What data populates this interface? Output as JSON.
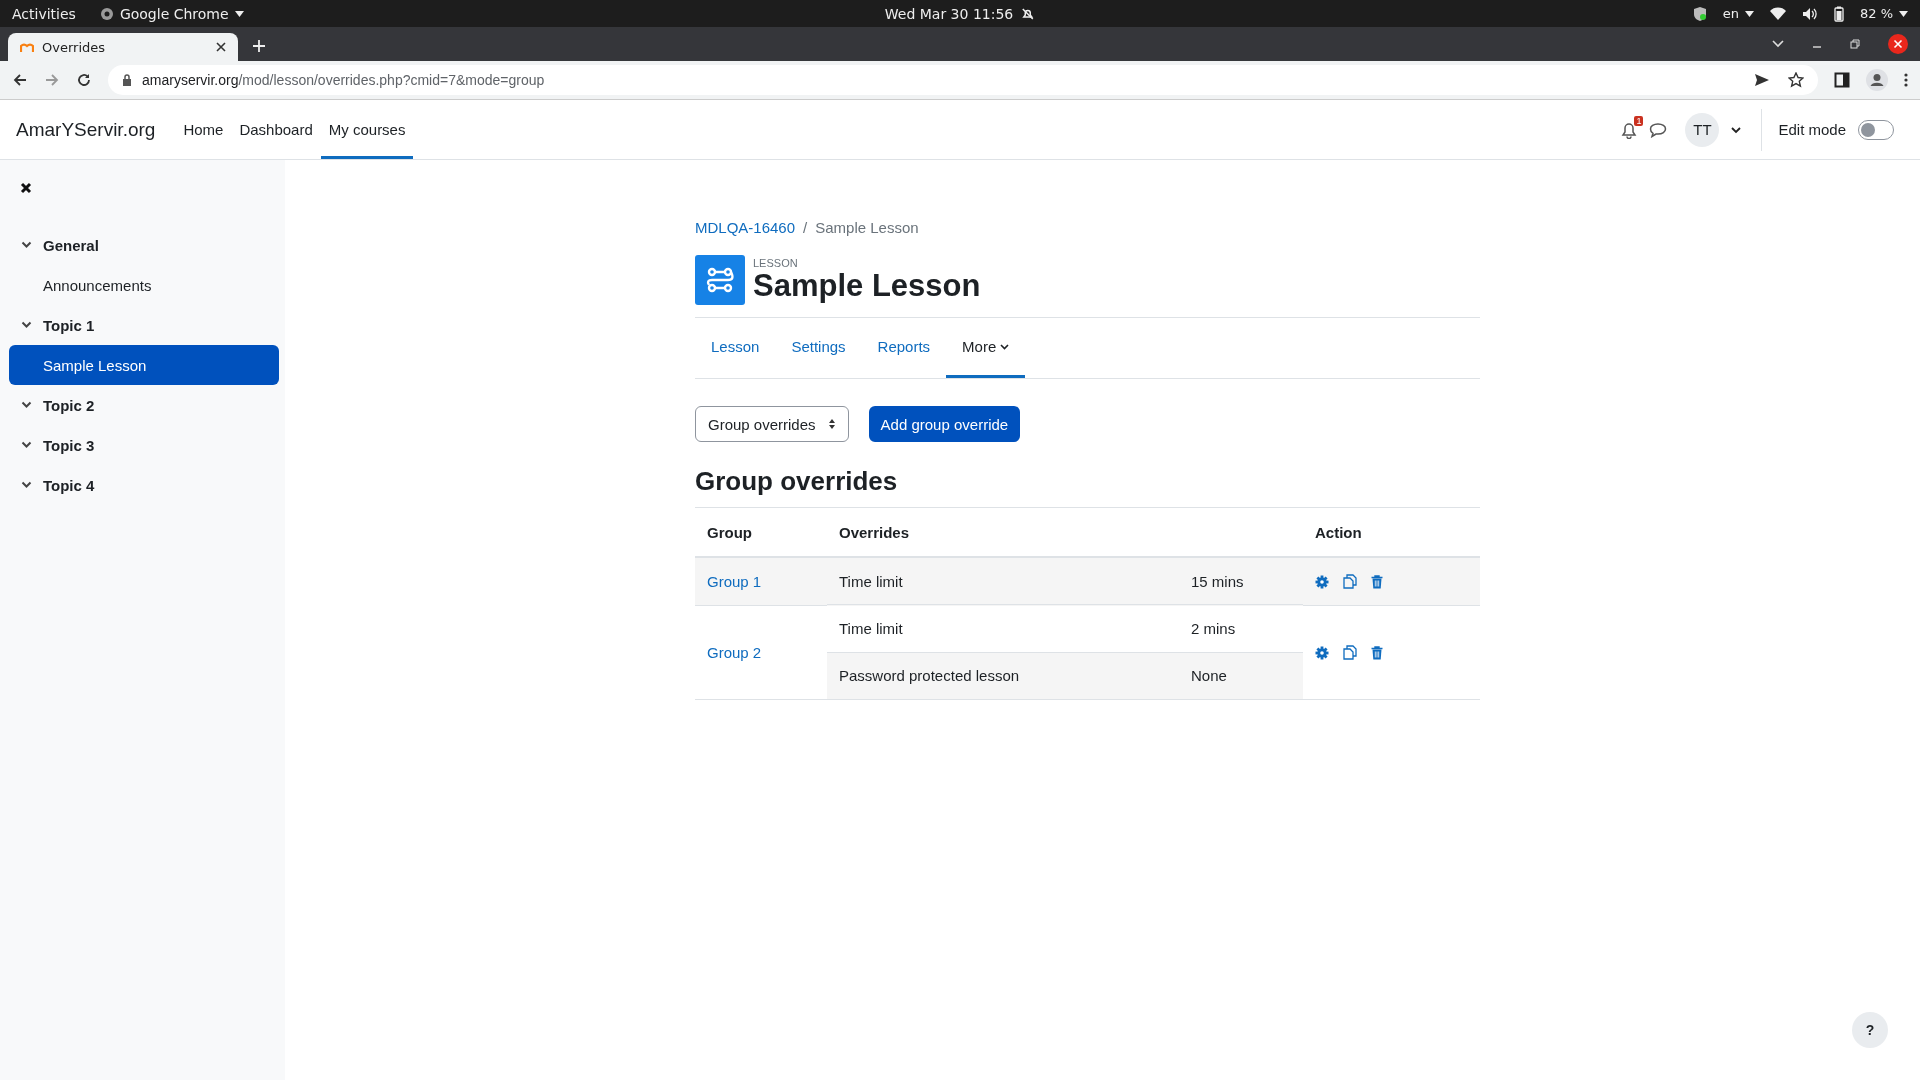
{
  "os_bar": {
    "activities": "Activities",
    "app_name": "Google Chrome",
    "clock": "Wed Mar 30  11:56",
    "language": "en",
    "battery": "82 %"
  },
  "browser": {
    "tab_title": "Overrides",
    "url_host": "amaryservir.org",
    "url_path": "/mod/lesson/overrides.php?cmid=7&mode=group"
  },
  "navbar": {
    "site_name": "AmarYServir.org",
    "links": [
      {
        "label": "Home",
        "selected": false
      },
      {
        "label": "Dashboard",
        "selected": false
      },
      {
        "label": "My courses",
        "selected": true
      }
    ],
    "notification_count": "1",
    "avatar_initials": "TT",
    "edit_mode": {
      "label": "Edit mode",
      "on": false
    }
  },
  "sidebar": {
    "sections": [
      {
        "label": "General",
        "expanded": true,
        "children": [
          {
            "label": "Announcements",
            "selected": false
          }
        ]
      },
      {
        "label": "Topic 1",
        "expanded": true,
        "children": [
          {
            "label": "Sample Lesson",
            "selected": true
          }
        ]
      },
      {
        "label": "Topic 2",
        "expanded": true
      },
      {
        "label": "Topic 3",
        "expanded": true
      },
      {
        "label": "Topic 4",
        "expanded": true
      }
    ]
  },
  "breadcrumb_separator": "/",
  "breadcrumb": [
    {
      "label": "MDLQA-16460",
      "kind": "link"
    },
    {
      "label": "Sample Lesson",
      "kind": "current"
    }
  ],
  "activity": {
    "type_label": "LESSON",
    "title": "Sample Lesson"
  },
  "tabs": [
    {
      "label": "Lesson",
      "selected": false,
      "kind": "link"
    },
    {
      "label": "Settings",
      "selected": false,
      "kind": "link"
    },
    {
      "label": "Reports",
      "selected": false,
      "kind": "link"
    },
    {
      "label": "More",
      "selected": true,
      "kind": "menu"
    }
  ],
  "mode_select": {
    "value": "Group overrides"
  },
  "add_button": "Add group override",
  "heading": "Group overrides",
  "table": {
    "columns": [
      "Group",
      "Overrides",
      "Action"
    ],
    "rows": [
      {
        "group": "Group 1",
        "overrides": [
          {
            "name": "Time limit",
            "value": "15 mins"
          }
        ]
      },
      {
        "group": "Group 2",
        "overrides": [
          {
            "name": "Time limit",
            "value": "2 mins"
          },
          {
            "name": "Password protected lesson",
            "value": "None"
          }
        ]
      }
    ]
  },
  "help_button": "?"
}
